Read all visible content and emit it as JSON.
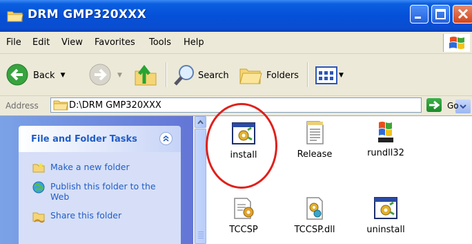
{
  "window": {
    "title": "DRM GMP320XXX"
  },
  "menu": {
    "items": [
      "File",
      "Edit",
      "View",
      "Favorites",
      "Tools",
      "Help"
    ]
  },
  "toolbar": {
    "back_label": "Back",
    "search_label": "Search",
    "folders_label": "Folders"
  },
  "address": {
    "label": "Address",
    "value": "D:\\DRM GMP320XXX",
    "go_label": "Go"
  },
  "tasks": {
    "title": "File and Folder Tasks",
    "items": [
      {
        "label": "Make a new folder",
        "icon": "new-folder-icon"
      },
      {
        "label": "Publish this folder to the Web",
        "icon": "publish-web-icon"
      },
      {
        "label": "Share this folder",
        "icon": "share-folder-icon"
      }
    ]
  },
  "files": [
    {
      "name": "install",
      "icon": "setup-application-icon"
    },
    {
      "name": "Release",
      "icon": "text-document-icon"
    },
    {
      "name": "rundll32",
      "icon": "windows-logo-icon"
    },
    {
      "name": "TCCSP",
      "icon": "config-document-icon"
    },
    {
      "name": "TCCSP.dll",
      "icon": "dll-file-icon"
    },
    {
      "name": "uninstall",
      "icon": "setup-application-icon"
    }
  ],
  "annotation": {
    "highlighted_item": "install",
    "color": "#e0201b"
  },
  "colors": {
    "titlebar": "#0550d8",
    "task_link": "#215dc6",
    "task_header_text": "#215dc6"
  }
}
